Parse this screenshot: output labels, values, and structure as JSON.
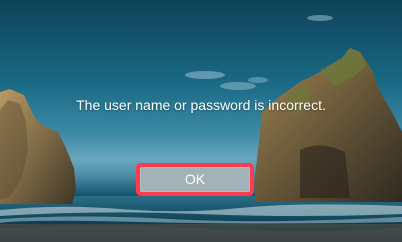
{
  "dialog": {
    "message": "The user name or password is incorrect.",
    "ok_label": "OK"
  },
  "colors": {
    "highlight": "#ff3b4f",
    "button_bg": "#a3b2b6",
    "text": "#ffffff"
  }
}
